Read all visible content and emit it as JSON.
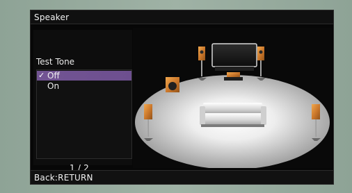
{
  "window": {
    "title": "Speaker"
  },
  "menu": {
    "heading": "Test Tone",
    "options": [
      {
        "label": "Off",
        "selected": true,
        "checked": true
      },
      {
        "label": "On",
        "selected": false,
        "checked": false
      }
    ],
    "page_indicator": "1 / 2"
  },
  "footer": {
    "hint": "Back:RETURN"
  },
  "icons": {
    "check": "check-icon"
  },
  "colors": {
    "selection": "#725493",
    "background": "#050505",
    "text": "#f0f0f0"
  }
}
